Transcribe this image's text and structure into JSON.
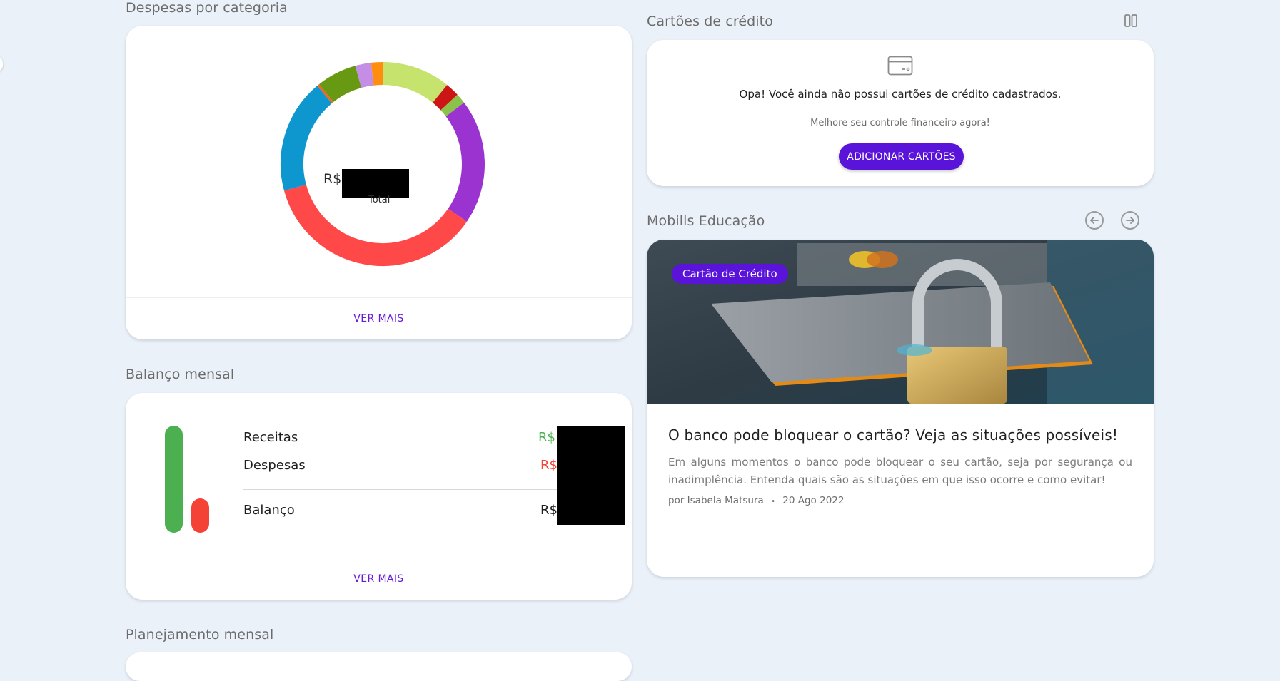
{
  "expenses": {
    "title": "Despesas por categoria",
    "currency": "R$",
    "total_label": "Total",
    "ver_mais": "VER MAIS",
    "colors": [
      "#c6e36e",
      "#cc1616",
      "#8bc34a",
      "#9a33cf",
      "#ff4949",
      "#0e97cf",
      "#e86a2a",
      "#679a12",
      "#c58ee6",
      "#ff8d10"
    ],
    "shares": [
      0.108,
      0.022,
      0.016,
      0.197,
      0.36,
      0.18,
      0.004,
      0.063,
      0.025,
      0.018
    ]
  },
  "balance": {
    "title": "Balanço mensal",
    "receitas_label": "Receitas",
    "despesas_label": "Despesas",
    "balanco_label": "Balanço",
    "currency": "R$",
    "income_color": "#4caf50",
    "expense_color": "#f44336",
    "ver_mais": "VER MAIS"
  },
  "credit_cards": {
    "title": "Cartões de crédito",
    "empty_message": "Opa! Você ainda não possui cartões de crédito cadastrados.",
    "sub_message": "Melhore seu controle financeiro agora!",
    "add_button": "ADICIONAR CARTÕES"
  },
  "education": {
    "title": "Mobills Educação",
    "tag": "Cartão de Crédito",
    "article_title": "O banco pode bloquear o cartão? Veja as situações possíveis!",
    "article_desc": "Em alguns momentos o banco pode bloquear o seu cartão, seja por segurança ou inadimplência. Entenda quais são as situações em que isso ocorre e como evitar!",
    "author": "por Isabela Matsura",
    "separator": "•",
    "date": "20 Ago 2022"
  },
  "planning": {
    "title": "Planejamento mensal"
  }
}
